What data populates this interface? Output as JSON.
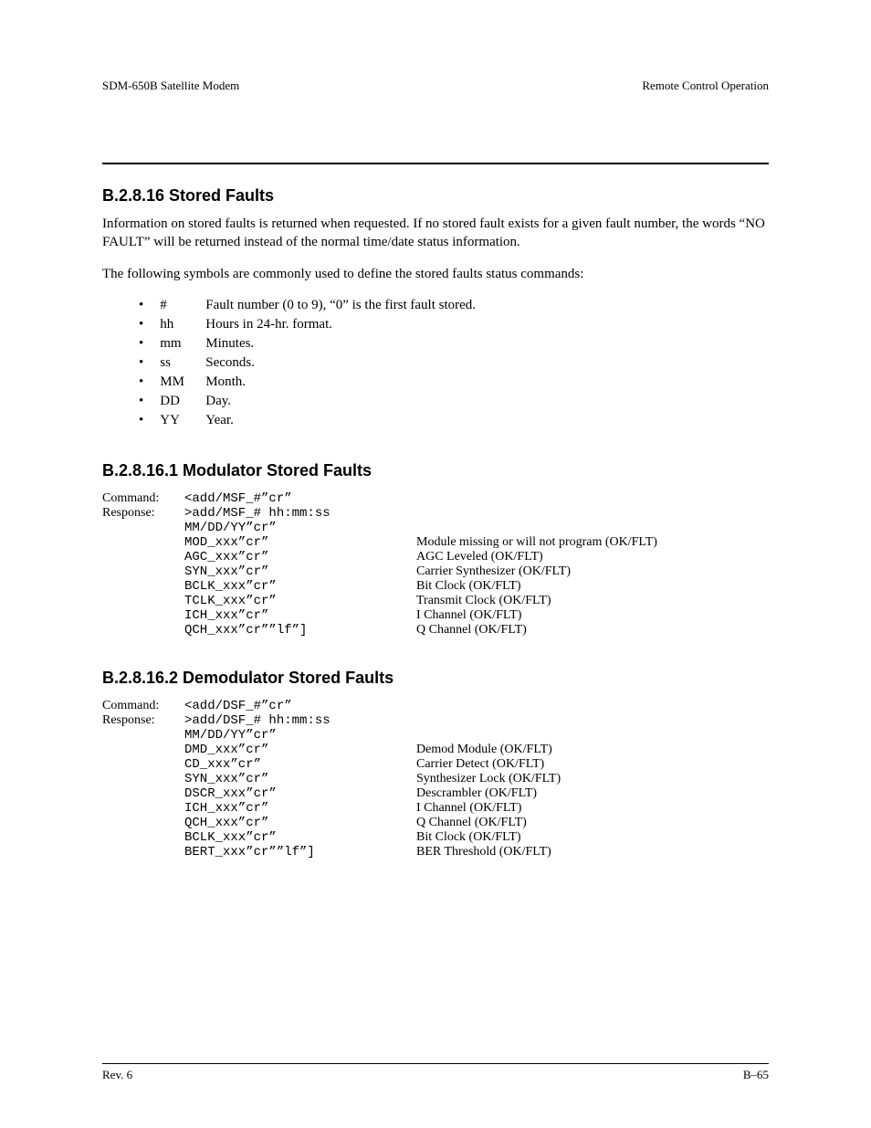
{
  "header": {
    "left": "SDM-650B Satellite Modem",
    "right": "Remote Control Operation"
  },
  "sections": {
    "s1": {
      "heading": "B.2.8.16  Stored Faults",
      "para1": "Information on stored faults is returned when requested. If no stored fault exists for a given fault number, the words “NO FAULT” will be returned instead of the normal time/date status information.",
      "para2": "The following symbols are commonly used to define the stored faults status commands:"
    },
    "symbols": [
      {
        "sym": "#",
        "desc": "Fault number (0 to 9), “0” is the first fault stored."
      },
      {
        "sym": "hh",
        "desc": "Hours in 24-hr. format."
      },
      {
        "sym": "mm",
        "desc": "Minutes."
      },
      {
        "sym": "ss",
        "desc": "Seconds."
      },
      {
        "sym": "MM",
        "desc": "Month."
      },
      {
        "sym": "DD",
        "desc": "Day."
      },
      {
        "sym": "YY",
        "desc": "Year."
      }
    ],
    "sub1": {
      "heading": "B.2.8.16.1  Modulator Stored Faults",
      "commandLabel": "Command:",
      "commandText": "<add/MSF_#”cr”",
      "responseLabel": "Response:",
      "responseHeader": ">add/MSF_# hh:mm:ss MM/DD/YY”cr”",
      "lines": [
        {
          "code": "MOD_xxx”cr”",
          "desc": "Module missing or will not program (OK/FLT)"
        },
        {
          "code": "AGC_xxx”cr”",
          "desc": "AGC Leveled (OK/FLT)"
        },
        {
          "code": "SYN_xxx”cr”",
          "desc": "Carrier Synthesizer (OK/FLT)"
        },
        {
          "code": "BCLK_xxx”cr”",
          "desc": "Bit Clock (OK/FLT)"
        },
        {
          "code": "TCLK_xxx”cr”",
          "desc": "Transmit Clock (OK/FLT)"
        },
        {
          "code": "ICH_xxx”cr”",
          "desc": "I Channel (OK/FLT)"
        },
        {
          "code": "QCH_xxx”cr””lf”]",
          "desc": "Q Channel (OK/FLT)"
        }
      ]
    },
    "sub2": {
      "heading": "B.2.8.16.2  Demodulator Stored Faults",
      "commandLabel": "Command:",
      "commandText": "<add/DSF_#”cr”",
      "responseLabel": "Response:",
      "responseHeader": ">add/DSF_# hh:mm:ss MM/DD/YY”cr”",
      "lines": [
        {
          "code": "DMD_xxx”cr”",
          "desc": "Demod Module (OK/FLT)"
        },
        {
          "code": "CD_xxx”cr”",
          "desc": "Carrier Detect (OK/FLT)"
        },
        {
          "code": "SYN_xxx”cr”",
          "desc": "Synthesizer Lock (OK/FLT)"
        },
        {
          "code": "DSCR_xxx”cr”",
          "desc": "Descrambler (OK/FLT)"
        },
        {
          "code": "ICH_xxx”cr”",
          "desc": "I Channel (OK/FLT)"
        },
        {
          "code": "QCH_xxx”cr”",
          "desc": "Q Channel (OK/FLT)"
        },
        {
          "code": "BCLK_xxx”cr”",
          "desc": "Bit Clock (OK/FLT)"
        },
        {
          "code": "BERT_xxx”cr””lf”]",
          "desc": "BER Threshold (OK/FLT)"
        }
      ]
    }
  },
  "footer": {
    "left": "Rev. 6",
    "right": "B–65"
  }
}
